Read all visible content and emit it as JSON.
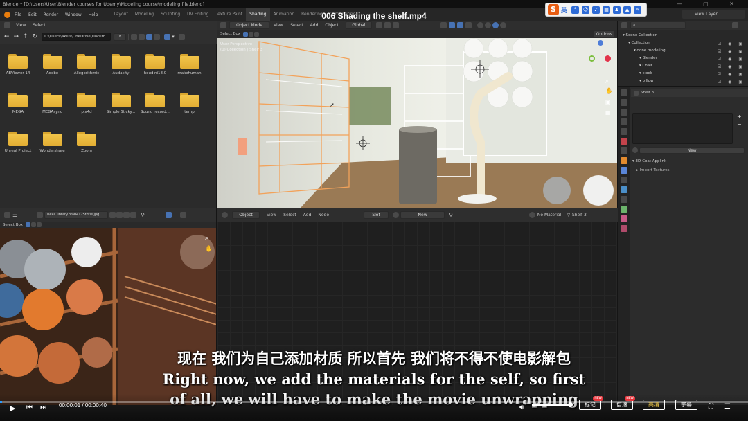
{
  "window": {
    "title": "Blender* [D:\\Users\\User\\Blender courses for Udemy\\Modeling course\\modeling file.blend]",
    "file_menu": [
      "File",
      "Edit",
      "Render",
      "Window",
      "Help"
    ]
  },
  "workspaces": {
    "tabs": [
      "Layout",
      "Modeling",
      "Sculpting",
      "UV Editing",
      "Texture Paint",
      "Shading",
      "Animation",
      "Rendering",
      "Compositing"
    ],
    "active": "Shading"
  },
  "video": {
    "title": "006 Shading the shelf.mp4"
  },
  "ime_toolbar": {
    "lang": "英",
    "logo": "S"
  },
  "view_layer": "View Layer",
  "file_browser": {
    "menu": [
      "View",
      "Select"
    ],
    "path": "C:\\Users\\akilis\\OneDrive\\Docum...",
    "folders": [
      "ABViewer 14",
      "Adobe",
      "Allegorithmic",
      "Audacity",
      "houdini18.0",
      "makehuman",
      "MEGA",
      "MEGAsync",
      "pix4d",
      "Simple Sticky...",
      "Sound record...",
      "temp",
      "Unreal Project",
      "Wondershare",
      "Zoom"
    ]
  },
  "viewport": {
    "mode": "Object Mode",
    "menu": [
      "View",
      "Select",
      "Add",
      "Object"
    ],
    "transform": "Global",
    "select_label": "Select Box",
    "options": "Options",
    "overlay_title": "User Perspective",
    "overlay_collection": "(0) Collection | Shelf 3"
  },
  "outliner": {
    "items": [
      {
        "label": "Scene Collection",
        "depth": 0
      },
      {
        "label": "Collection",
        "depth": 1
      },
      {
        "label": "done modeling",
        "depth": 2
      },
      {
        "label": "Blender",
        "depth": 3
      },
      {
        "label": "Chair",
        "depth": 3
      },
      {
        "label": "clock",
        "depth": 3
      },
      {
        "label": "pillow",
        "depth": 3
      }
    ]
  },
  "properties": {
    "object_name": "Shelf 3",
    "new_button": "New",
    "panel": "3D-Coat Applink",
    "subpanel": "Import Textures"
  },
  "image_editor": {
    "image_name": "hexa library.bfa04125fdfle.jpg",
    "select_label": "Select Box"
  },
  "node_editor": {
    "editor": "Object",
    "menu": [
      "View",
      "Select",
      "Add",
      "Node"
    ],
    "slot": "Slot",
    "new_button": "New",
    "material": "No Material",
    "object_name": "Shelf 3"
  },
  "subtitles": {
    "chinese": "现在 我们为自己添加材质 所以首先 我们将不得不使电影解包",
    "english_1": "Right now, we add the materials for the self, so first",
    "english_2": "of all, we will have to make the movie unwrapping"
  },
  "player": {
    "current_time": "00:00:01",
    "duration": "00:00:40",
    "progress": 0.0025,
    "volume": 0.9,
    "buttons": [
      {
        "label": "标记",
        "new": true
      },
      {
        "label": "倍速",
        "new": true
      },
      {
        "label": "高清",
        "new": false
      },
      {
        "label": "字幕",
        "new": false
      }
    ],
    "new_tag": "NEW"
  },
  "colors": {
    "accent_blue": "#2a9cff",
    "hd_highlight": "#ffd44a",
    "folder_yellow": "#f2c54a",
    "selection_blue": "#334d80"
  }
}
